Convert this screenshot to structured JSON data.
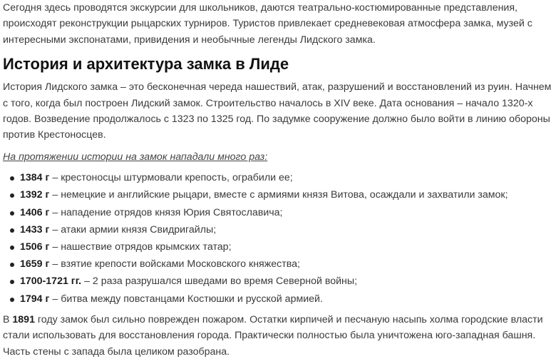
{
  "intro": {
    "text": "Сегодня здесь проводятся экскурсии для школьников, даются театрально-костюмированные представления, происходят реконструкции рыцарских турниров. Туристов привлекает средневековая атмосфера замка, музей с интересными экспонатами, привидения и необычные легенды Лидского замка."
  },
  "heading": "История и архитектура замка в Лиде",
  "history": {
    "text": "История Лидского замка – это бесконечная череда нашествий, атак, разрушений и восстановлений из руин. Начнем с того, когда был построен Лидский замок. Строительство началось в XIV веке. Дата основания – начало 1320-х годов. Возведение продолжалось с 1323 по 1325 год. По задумке сооружение должно было войти в линию обороны против Крестоносцев."
  },
  "attacks_intro": "На протяжении истории на замок нападали много раз:",
  "events": [
    {
      "year": "1384 г",
      "text": " – крестоносцы штурмовали крепость, ограбили ее;"
    },
    {
      "year": "1392 г",
      "text": " – немецкие и английские рыцари, вместе с армиями князя Витова, осаждали и захватили замок;"
    },
    {
      "year": "1406 г",
      "text": " – нападение отрядов князя Юрия Святославича;"
    },
    {
      "year": "1433 г",
      "text": " – атаки армии князя Свидригайлы;"
    },
    {
      "year": "1506 г",
      "text": " – нашествие отрядов крымских татар;"
    },
    {
      "year": "1659 г",
      "text": " – взятие крепости войсками Московского княжества;"
    },
    {
      "year": "1700-1721 гг.",
      "text": " – 2 раза разрушался шведами во время Северной войны;"
    },
    {
      "year": "1794 г",
      "text": " – битва между повстанцами Костюшки и русской армией."
    }
  ],
  "fire": {
    "prefix": "В ",
    "year": "1891",
    "text": " году замок был сильно поврежден пожаром. Остатки кирпичей и песчаную насыпь холма городские власти стали использовать для восстановления города. Практически полностью была уничтожена юго-западная башня. Часть стены с запада была целиком разобрана."
  }
}
